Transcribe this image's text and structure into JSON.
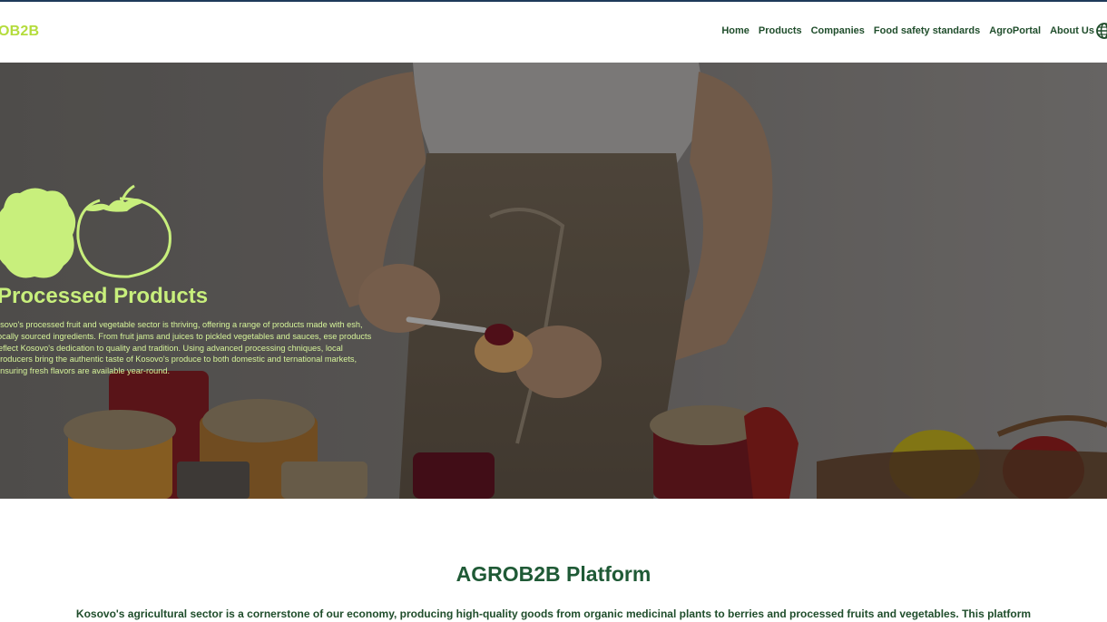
{
  "header": {
    "logo": "OB2B",
    "nav": [
      "Home",
      "Products",
      "Companies",
      "Food safety standards",
      "AgroPortal",
      "About Us"
    ]
  },
  "hero": {
    "title": "Processed Products",
    "text": "osovo's processed fruit and vegetable sector is thriving, offering a range of products made with esh, locally sourced ingredients. From fruit jams and juices to pickled vegetables and sauces, ese products reflect Kosovo's dedication to quality and tradition. Using advanced processing chniques, local producers bring the authentic taste of Kosovo's produce to both domestic and ternational markets, ensuring fresh flavors are available year-round."
  },
  "platform": {
    "title": "AGROB2B Platform",
    "text": "Kosovo's agricultural sector is a cornerstone of our economy, producing high-quality goods from organic medicinal plants to berries and processed fruits and vegetables. This platform"
  },
  "colors": {
    "accent": "#c8ef7c",
    "nav_text": "#1f4d2b",
    "heading": "#1f5a36"
  },
  "icons": [
    "globe-icon",
    "raspberry-icon",
    "tomato-icon"
  ]
}
